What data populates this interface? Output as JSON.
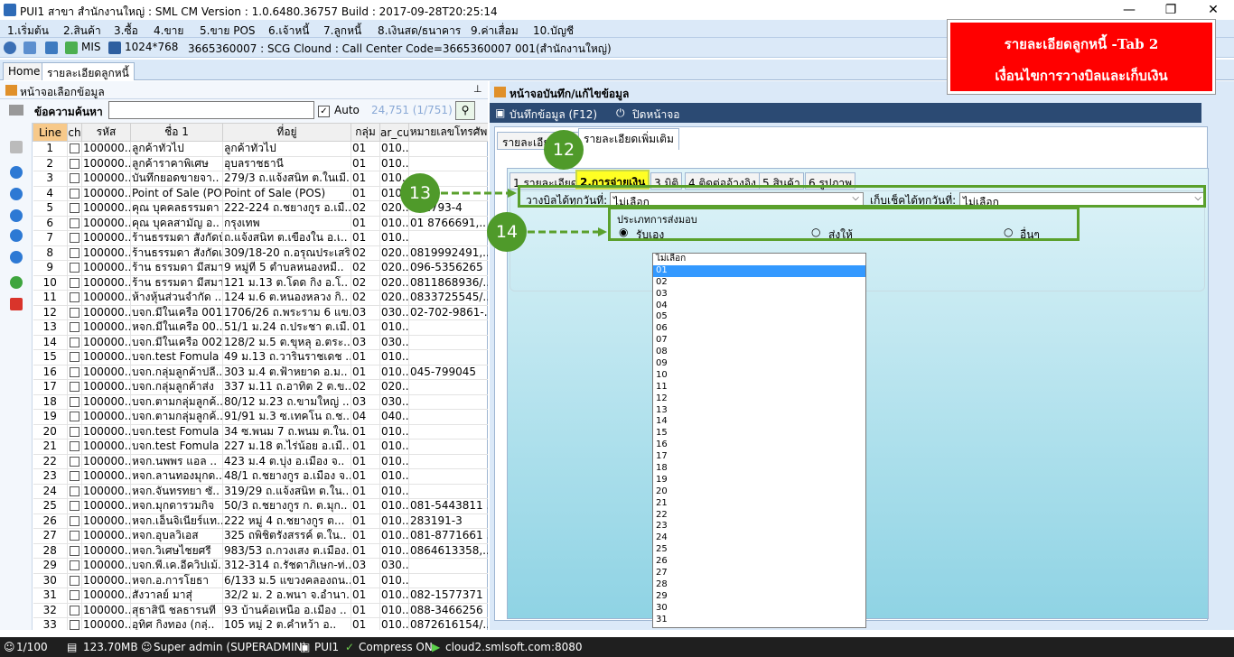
{
  "window": {
    "title": "PUI1 สาขา สำนักงานใหญ่ : SML CM Version : 1.0.6480.36757  Build : 2017-09-28T20:25:14",
    "minimize": "—",
    "maximize": "❐",
    "close": "✕"
  },
  "menu": [
    "1.เริ่มต้น",
    "2.สินค้า",
    "3.ซื้อ",
    "4.ขาย",
    "5.ขาย POS",
    "6.เจ้าหนี้",
    "7.ลูกหนี้",
    "8.เงินสด/ธนาคาร",
    "9.ค่าเสื่อม",
    "10.บัญชี"
  ],
  "toolbar": {
    "mis": "MIS",
    "resolution": "1024*768",
    "info": "3665360007 : SCG Clound : Call Center Code=3665360007 001(สำนักงานใหญ่)"
  },
  "doc_tabs": [
    "Home",
    "รายละเอียดลูกหนี้"
  ],
  "left": {
    "title": "หน้าจอเลือกข้อมูล",
    "search_label": "ข้อความค้นหา",
    "search_value": "",
    "auto_label": "Auto",
    "count": "24,751 (1/751)",
    "columns": [
      "Line",
      "ch",
      "รหัส",
      "ชื่อ 1",
      "ที่อยู่",
      "กลุ่ม",
      "ar_cu",
      "หมายเลขโทรศัพ"
    ],
    "rows": [
      [
        "1",
        "100000..",
        "ลูกค้าทั่วไป",
        "ลูกค้าทั่วไป",
        "01",
        "010..",
        ""
      ],
      [
        "2",
        "100000..",
        "ลูกค้าราคาพิเศษ",
        "อุบลราชธานี",
        "01",
        "010..",
        ""
      ],
      [
        "3",
        "100000..",
        "บันทึกยอดขายจา..",
        "279/3 ถ.แจ้งสนิท ต.ในเมื..",
        "01",
        "010..",
        ""
      ],
      [
        "4",
        "100000..",
        "Point of Sale (PO..",
        "Point of Sale (POS)",
        "01",
        "010..",
        ""
      ],
      [
        "5",
        "100000..",
        "คุณ บุคคลธรรมดา ..",
        "222-224 ถ.ชยางกูร อ.เมื..",
        "02",
        "020..",
        "611793-4"
      ],
      [
        "6",
        "100000..",
        "คุณ บุคลสามัญ อ..",
        "กรุงเทพ",
        "01",
        "010..",
        "01 8766691,.."
      ],
      [
        "7",
        "100000..",
        "ร้านธรรมดา สังกัดบ้..",
        "ถ.แจ้งสนิท ต.เขื่องใน อ.เ..",
        "01",
        "010..",
        ""
      ],
      [
        "8",
        "100000..",
        "ร้านธรรมดา สังกัดเ..",
        "309/18-20 ถ.อรุณประเสริ..",
        "02",
        "020..",
        "0819992491,.."
      ],
      [
        "9",
        "100000..",
        "ร้าน ธรรมดา มีสมา..",
        "9 หมู่ที่ 5 ตำบลหนองหมื..",
        "02",
        "020..",
        "096-5356265"
      ],
      [
        "10",
        "100000..",
        "ร้าน ธรรมดา มีสมา..",
        "121 ม.13 ต.โดด กิ่ง อ.โ..",
        "02",
        "020..",
        "0811868936/.."
      ],
      [
        "11",
        "100000..",
        "ห้างหุ้นส่วนจำกัด ..",
        "124 ม.6 ต.หนองหลวง กิ..",
        "02",
        "020..",
        "0833725545/.."
      ],
      [
        "12",
        "100000..",
        "บจก.มีในเครือ 001",
        "1706/26 ถ.พระราม 6 แข..",
        "03",
        "030..",
        "02-702-9861-.."
      ],
      [
        "13",
        "100000..",
        "หจก.มีในเครือ 00..",
        "51/1 ม.24 ถ.ประชา ต.เมื..",
        "01",
        "010..",
        ""
      ],
      [
        "14",
        "100000..",
        "บจก.มีในเครือ 002",
        "128/2 ม.5 ต.ขุหลุ อ.ตระ..",
        "03",
        "030..",
        ""
      ],
      [
        "15",
        "100000..",
        "บจก.test Fomula ..",
        "49 ม.13 ถ.วารินราชเดช ..",
        "01",
        "010..",
        ""
      ],
      [
        "16",
        "100000..",
        "บจก.กลุ่มลูกค้าปลี..",
        "303 ม.4 ต.ฟ้าหยาด อ.ม..",
        "01",
        "010..",
        "045-799045"
      ],
      [
        "17",
        "100000..",
        "บจก.กลุ่มลูกค้าส่ง",
        "337 ม.11 ถ.อาทิต 2 ต.ข..",
        "02",
        "020..",
        ""
      ],
      [
        "18",
        "100000..",
        "บจก.ตามกลุ่มลูกค้..",
        "80/12 ม.23 ถ.ขามใหญ่ ..",
        "03",
        "030..",
        ""
      ],
      [
        "19",
        "100000..",
        "บจก.ตามกลุ่มลูกค้..",
        "91/91 ม.3 ซ.เทคโน ถ.ช..",
        "04",
        "040..",
        ""
      ],
      [
        "20",
        "100000..",
        "บจก.test Fomula ..",
        "34 ซ.พนม 7 ถ.พนม ต.ใน..",
        "01",
        "010..",
        ""
      ],
      [
        "21",
        "100000..",
        "บจก.test Fomula ..",
        "227 ม.18 ต.ไร่น้อย อ.เมื..",
        "01",
        "010..",
        ""
      ],
      [
        "22",
        "100000..",
        "หจก.นพพร แอล ..",
        "423 ม.4 ต.บุ่ง อ.เมือง จ..",
        "01",
        "010..",
        ""
      ],
      [
        "23",
        "100000..",
        "หจก.ลานทองมุกด..",
        "48/1 ถ.ชยางกูร อ.เมือง จ..",
        "01",
        "010..",
        ""
      ],
      [
        "24",
        "100000..",
        "หจก.จันทรทยา ซั..",
        "319/29 ถ.แจ้งสนิท ต.ใน..",
        "01",
        "010..",
        ""
      ],
      [
        "25",
        "100000..",
        "หจก.มุกดารวมกิจ",
        "50/3 ถ.ชยางกูร ก. ต.มุก..",
        "01",
        "010..",
        "081-5443811 .."
      ],
      [
        "26",
        "100000..",
        "หจก.เอ็นจิเนียร์แท..",
        "222 หมู่ 4 ถ.ชยางกูร ต...",
        "01",
        "010..",
        "283191-3"
      ],
      [
        "27",
        "100000..",
        "หจก.อุบลวิเอส",
        "325 ถพิชิตรังสรรค์ ต.ใน..",
        "01",
        "010..",
        "081-8771661 .."
      ],
      [
        "28",
        "100000..",
        "หจก.วิเศษไชยศรี",
        "983/53 ถ.กวงเสง ต.เมือง..",
        "01",
        "010..",
        "0864613358,.."
      ],
      [
        "29",
        "100000..",
        "บจก.พี.เค.อีควิปเม้..",
        "312-314 ถ.รัชดาภิเษก-ท่..",
        "03",
        "030..",
        ""
      ],
      [
        "30",
        "100000..",
        "หจก.อ.การโยธา",
        "6/133 ม.5 แขวงคลองถน..",
        "01",
        "010..",
        ""
      ],
      [
        "31",
        "100000..",
        "สังวาลย์ มาสุ่",
        "32/2 ม. 2 อ.พนา จ.อำนา..",
        "01",
        "010..",
        "082-1577371"
      ],
      [
        "32",
        "100000..",
        "สุธาสินี ชลธารนที",
        "93 บ้านค้อเหนือ อ.เมือง ..",
        "01",
        "010..",
        "088-3466256"
      ],
      [
        "33",
        "100000..",
        "อุทิศ กิ่งทอง (กลุ่..",
        "105 หมู่ 2 ต.คำหว้า อ..",
        "01",
        "010..",
        "0872616154/.."
      ]
    ]
  },
  "right": {
    "title": "หน้าจอบันทึก/แก้ไขข้อมูล",
    "save": "บันทึกข้อมูล (F12)",
    "close": "ปิดหน้าจอ",
    "form_tabs": [
      "รายละเอียดลูกหนี้",
      "รายละเอียดเพิ่มเติม"
    ],
    "sub_tabs": [
      "1.รายละเอียด",
      "2.การจ่ายเงิน",
      "3.มิติ",
      "4.ติดต่ออ้างอิง",
      "5.สินค้า",
      "6.รูปภาพ"
    ],
    "bill_label": "วางบิลได้ทุกวันที่:",
    "bill_value": "ไม่เลือก",
    "cheque_label": "เก็บเช็คได้ทุกวันที่:",
    "cheque_value": "ไม่เลือก",
    "delivery_label": "ประเภทการส่งมอบ",
    "delivery_options": [
      "รับเอง",
      "ส่งให้",
      "อื่นๆ"
    ],
    "dropdown": [
      "ไม่เลือก",
      "01",
      "02",
      "03",
      "04",
      "05",
      "06",
      "07",
      "08",
      "09",
      "10",
      "11",
      "12",
      "13",
      "14",
      "15",
      "16",
      "17",
      "18",
      "19",
      "20",
      "21",
      "22",
      "23",
      "24",
      "25",
      "26",
      "27",
      "28",
      "29",
      "30",
      "31"
    ]
  },
  "annotation": {
    "title": "รายละเอียดลูกหนี้ -Tab 2",
    "subtitle": "เงื่อนไขการวางบิลและเก็บเงิน",
    "n12": "12",
    "n13": "13",
    "n14": "14"
  },
  "status": {
    "page": "1/100",
    "memory": "123.70MB",
    "user": "Super admin (SUPERADMIN)",
    "branch": "PUI1",
    "compress": "Compress ON",
    "server": "cloud2.smlsoft.com:8080"
  }
}
